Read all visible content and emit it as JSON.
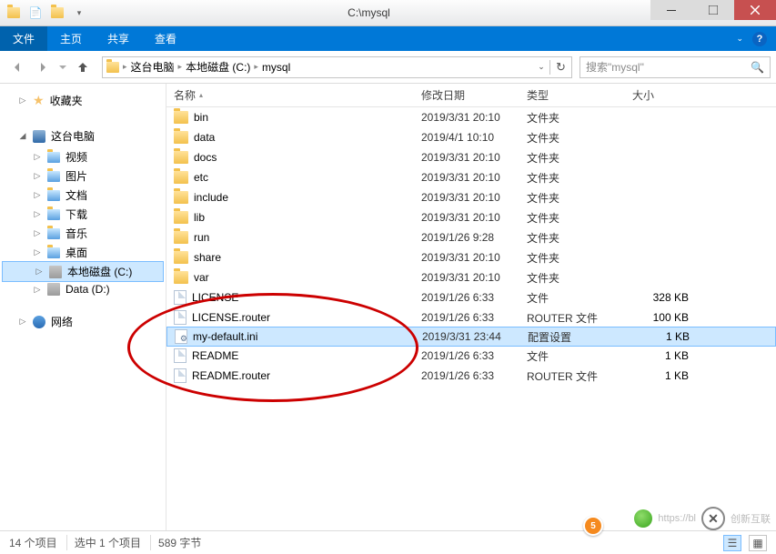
{
  "titlebar": {
    "path": "C:\\mysql"
  },
  "ribbon": {
    "file": "文件",
    "tabs": [
      "主页",
      "共享",
      "查看"
    ]
  },
  "breadcrumb": {
    "parts": [
      "这台电脑",
      "本地磁盘 (C:)",
      "mysql"
    ]
  },
  "search": {
    "placeholder": "搜索\"mysql\""
  },
  "sidebar": {
    "favorites": "收藏夹",
    "thispc": "这台电脑",
    "pc_items": [
      "视频",
      "图片",
      "文档",
      "下载",
      "音乐",
      "桌面",
      "本地磁盘 (C:)",
      "Data (D:)"
    ],
    "network": "网络"
  },
  "columns": {
    "name": "名称",
    "date": "修改日期",
    "type": "类型",
    "size": "大小"
  },
  "rows": [
    {
      "icon": "fold",
      "name": "bin",
      "date": "2019/3/31 20:10",
      "type": "文件夹",
      "size": ""
    },
    {
      "icon": "fold",
      "name": "data",
      "date": "2019/4/1 10:10",
      "type": "文件夹",
      "size": ""
    },
    {
      "icon": "fold",
      "name": "docs",
      "date": "2019/3/31 20:10",
      "type": "文件夹",
      "size": ""
    },
    {
      "icon": "fold",
      "name": "etc",
      "date": "2019/3/31 20:10",
      "type": "文件夹",
      "size": ""
    },
    {
      "icon": "fold",
      "name": "include",
      "date": "2019/3/31 20:10",
      "type": "文件夹",
      "size": ""
    },
    {
      "icon": "fold",
      "name": "lib",
      "date": "2019/3/31 20:10",
      "type": "文件夹",
      "size": ""
    },
    {
      "icon": "fold",
      "name": "run",
      "date": "2019/1/26 9:28",
      "type": "文件夹",
      "size": ""
    },
    {
      "icon": "fold",
      "name": "share",
      "date": "2019/3/31 20:10",
      "type": "文件夹",
      "size": ""
    },
    {
      "icon": "fold",
      "name": "var",
      "date": "2019/3/31 20:10",
      "type": "文件夹",
      "size": ""
    },
    {
      "icon": "doc",
      "name": "LICENSE",
      "date": "2019/1/26 6:33",
      "type": "文件",
      "size": "328 KB"
    },
    {
      "icon": "doc",
      "name": "LICENSE.router",
      "date": "2019/1/26 6:33",
      "type": "ROUTER 文件",
      "size": "100 KB"
    },
    {
      "icon": "ini",
      "name": "my-default.ini",
      "date": "2019/3/31 23:44",
      "type": "配置设置",
      "size": "1 KB",
      "selected": true
    },
    {
      "icon": "doc",
      "name": "README",
      "date": "2019/1/26 6:33",
      "type": "文件",
      "size": "1 KB"
    },
    {
      "icon": "doc",
      "name": "README.router",
      "date": "2019/1/26 6:33",
      "type": "ROUTER 文件",
      "size": "1 KB"
    }
  ],
  "status": {
    "count": "14 个项目",
    "selected": "选中 1 个项目",
    "bytes": "589 字节"
  },
  "watermark": {
    "text": "创新互联",
    "url": "https://bl"
  }
}
